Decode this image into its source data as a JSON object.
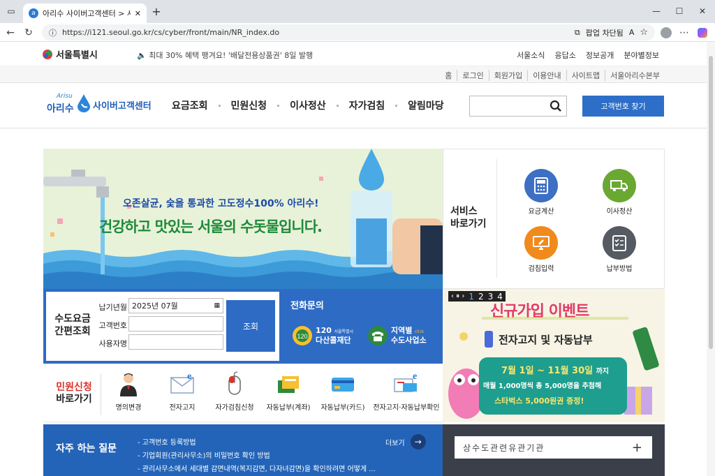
{
  "browser": {
    "tab_title": "아리수 사이버고객센터 > 사이버",
    "url": "https://i121.seoul.go.kr/cs/cyber/front/main/NR_index.do",
    "popup_blocked": "팝업 차단됨"
  },
  "top": {
    "seoul_logo": "서울특별시",
    "notice": "최대 30% 혜택 팽겨요! '배달전용상품권' 8일 발행",
    "links": [
      "서울소식",
      "응답소",
      "정보공개",
      "분야별정보"
    ]
  },
  "util": {
    "links": [
      "홈",
      "로그인",
      "회원가입",
      "이용안내",
      "사이트맵",
      "서울아리수본부"
    ]
  },
  "gnb": {
    "logo_small": "Arisu",
    "logo_name": "아리수",
    "logo_sub": "사이버고객센터",
    "menu": [
      "요금조회",
      "민원신청",
      "이사정산",
      "자가검침",
      "알림마당"
    ],
    "find_button": "고객번호 찾기"
  },
  "banner": {
    "line1": "오존살균, 숯을 통과한 고도정수100% 아리수!",
    "line2": "건강하고 맛있는 서울의 수돗물입니다."
  },
  "service": {
    "title_line1": "서비스",
    "title_line2": "바로가기",
    "items": [
      {
        "label": "요금계산",
        "color": "#3d6fc4"
      },
      {
        "label": "이사정산",
        "color": "#6aa832"
      },
      {
        "label": "검침입력",
        "color": "#f08a1c"
      },
      {
        "label": "납부방법",
        "color": "#555a63"
      }
    ]
  },
  "quick": {
    "title_line1": "수도요금",
    "title_line2": "간편조회",
    "fields": [
      {
        "label": "납기년월",
        "value": "2025년 07월"
      },
      {
        "label": "고객번호",
        "value": ""
      },
      {
        "label": "사용자명",
        "value": ""
      }
    ],
    "submit": "조회"
  },
  "phone": {
    "title": "전화문의",
    "left_num": "120",
    "left_small": "서울특별시",
    "left_name": "다산콜재단",
    "right_line1": "지역별",
    "right_click": "click",
    "right_line2": "수도사업소"
  },
  "event": {
    "controls": "‹ ⏸ ›",
    "pages": [
      "1",
      "2",
      "3",
      "4"
    ],
    "title": "신규가입 이벤트",
    "subtitle": "전자고지 및 자동납부",
    "period": "7월 1일 ~ 11월 30일",
    "period_suffix": "까지",
    "desc1": "매월 1,000명씩 총 5,000명을 추첨해",
    "desc2": "스타벅스 5,000원권 증정!"
  },
  "civil": {
    "title_line1": "민원신청",
    "title_line2": "바로가기",
    "items": [
      "명의변경",
      "전자고지",
      "자가검침신청",
      "자동납부(계좌)",
      "자동납부(카드)",
      "전자고지·자동납부확인"
    ]
  },
  "faq": {
    "title": "자주 하는 질문",
    "more": "더보기",
    "items": [
      "- 고객번호 등록방법",
      "- 기업회원(관리사무소)의 비밀번호 확인 방법",
      "- 관리사무소에서 세대별 감면내역(복지감면, 다자녀감면)을 확인하려면 어떻게 ..."
    ]
  },
  "related": {
    "label": "상수도관련유관기관"
  }
}
